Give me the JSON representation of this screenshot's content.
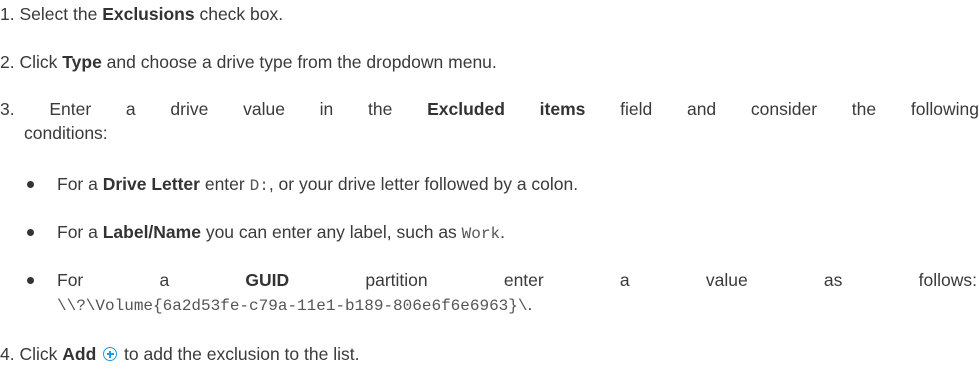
{
  "steps": [
    {
      "num": "1.",
      "pre": "Select the ",
      "bold": "Exclusions",
      "post": " check box."
    },
    {
      "num": "2.",
      "pre": "Click ",
      "bold": "Type",
      "post": " and choose a drive type from the dropdown menu."
    },
    {
      "num": "3.",
      "pre": "Enter a drive value in the ",
      "bold": "Excluded items",
      "post": " field and consider the following",
      "cont": "conditions:"
    },
    {
      "num": "4.",
      "pre": "Click ",
      "bold": "Add",
      "icon": "add-circle-icon",
      "post": " to add the exclusion to the list."
    }
  ],
  "bullets": [
    {
      "pre": "For a ",
      "bold": "Drive Letter",
      "mid": " enter ",
      "code": "D:",
      "post": ", or your drive letter followed by a colon."
    },
    {
      "pre": "For a ",
      "bold": "Label/Name",
      "mid": " you can enter any label, such as ",
      "code": "Work",
      "post": "."
    },
    {
      "pre": "For a ",
      "bold": "GUID",
      "mid": " partition enter a value as follows:",
      "code": "\\\\?\\Volume{6a2d53fe-c79a-11e1-b189-806e6f6e6963}\\",
      "post": "."
    }
  ],
  "colors": {
    "text": "#3a3a3a",
    "icon_accent": "#1b9be0"
  }
}
